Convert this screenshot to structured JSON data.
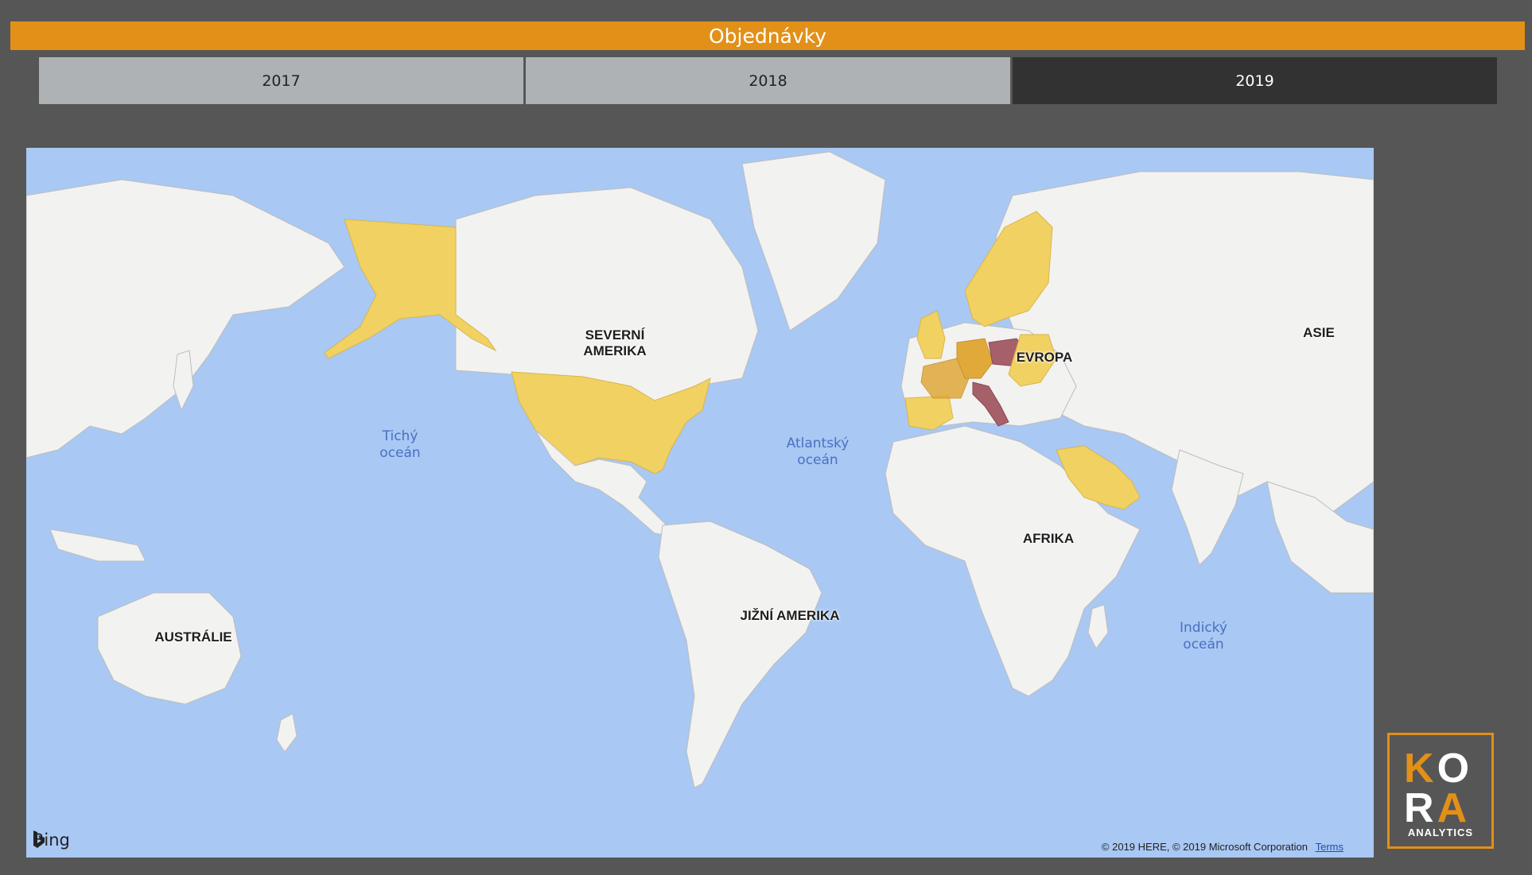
{
  "header": {
    "title": "Objednávky"
  },
  "year_tabs": [
    {
      "label": "2017",
      "selected": false
    },
    {
      "label": "2018",
      "selected": false
    },
    {
      "label": "2019",
      "selected": true
    }
  ],
  "map": {
    "continent_labels": {
      "north_america": "SEVERNÍ\nAMERIKA",
      "europe": "EVROPA",
      "asia": "ASIE",
      "africa": "AFRIKA",
      "south_america": "JIŽNÍ AMERIKA",
      "australia": "AUSTRÁLIE"
    },
    "ocean_labels": {
      "pacific": "Tichý\noceán",
      "atlantic": "Atlantský\noceán",
      "indian": "Indický\noceán"
    },
    "provider": "Bing",
    "copyright": "© 2019 HERE, © 2019 Microsoft Corporation",
    "terms_link": "Terms",
    "colors": {
      "water": "#a9c8f3",
      "land": "#f2f2f0",
      "low": "#f2d163",
      "mid": "#e0a93a",
      "high": "#a6606a"
    }
  },
  "logo": {
    "top": "KO",
    "bottom": "RA",
    "subtitle": "ANALYTICS",
    "accent": "#e29018"
  }
}
